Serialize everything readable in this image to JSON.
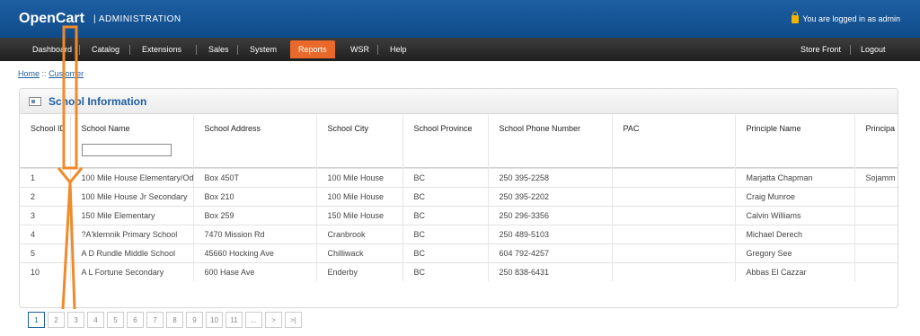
{
  "header": {
    "logo": "OpenCart",
    "subtitle": "| ADMINISTRATION",
    "logged_in": "You are logged in as admin"
  },
  "menu": {
    "items": [
      {
        "label": "Dashboard",
        "active": false
      },
      {
        "label": "Catalog",
        "active": false
      },
      {
        "label": "Extensions",
        "active": false
      },
      {
        "label": "Sales",
        "active": false
      },
      {
        "label": "System",
        "active": false
      },
      {
        "label": "Reports",
        "active": true
      },
      {
        "label": "WSR",
        "active": false
      },
      {
        "label": "Help",
        "active": false
      }
    ],
    "right": [
      {
        "label": "Store Front"
      },
      {
        "label": "Logout"
      }
    ]
  },
  "breadcrumb": {
    "home": "Home",
    "separator": "::",
    "current": "Customer"
  },
  "panel": {
    "title": "School Information"
  },
  "table": {
    "columns": [
      "School ID",
      "School Name",
      "School Address",
      "School City",
      "School Province",
      "School Phone Number",
      "PAC",
      "Principle Name",
      "Principa"
    ],
    "rows": [
      [
        "1",
        "100 Mile House Elementary/Od",
        "Box 450T",
        "100 Mile House",
        "BC",
        "250 395-2258",
        "",
        "Marjatta Chapman",
        "Sojamm"
      ],
      [
        "2",
        "100 Mile House Jr Secondary",
        "Box 210",
        "100 Mile House",
        "BC",
        "250 395-2202",
        "",
        "Craig Munroe",
        ""
      ],
      [
        "3",
        "150 Mile Elementary",
        "Box 259",
        "150 Mile House",
        "BC",
        "250 296-3356",
        "",
        "Calvin Williams",
        ""
      ],
      [
        "4",
        "?A'klemnik Primary School",
        "7470 Mission Rd",
        "Cranbrook",
        "BC",
        "250 489-5103",
        "",
        "Michael Derech",
        ""
      ],
      [
        "5",
        "A D Rundle Middle School",
        "45660 Hocking Ave",
        "Chilliwack",
        "BC",
        "604 792-4257",
        "",
        "Gregory See",
        ""
      ],
      [
        "10",
        "A L Fortune Secondary",
        "600 Hase Ave",
        "Enderby",
        "BC",
        "250 838-6431",
        "",
        "Abbas El Cazzar",
        ""
      ]
    ]
  },
  "pagination": [
    "1",
    "2",
    "3",
    "4",
    "5",
    "6",
    "7",
    "8",
    "9",
    "10",
    "11",
    "...",
    ">",
    ">|"
  ],
  "colors": {
    "header": "#1d5fa2",
    "menu": "#2b2b2b",
    "active": "#e8692a",
    "annotation": "#f08a2a"
  }
}
